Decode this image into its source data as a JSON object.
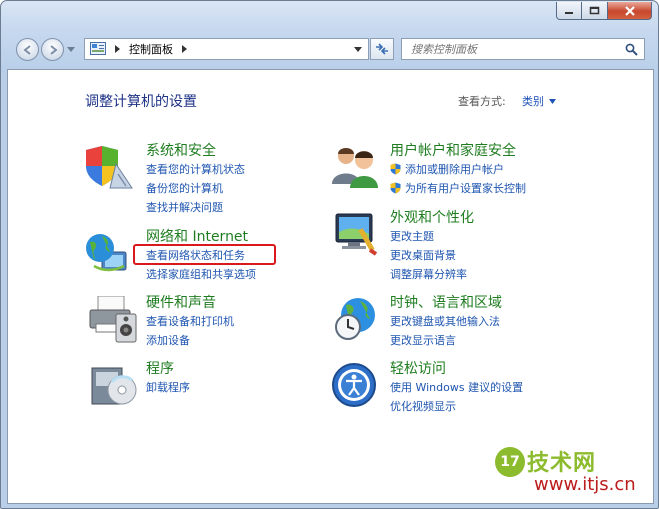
{
  "window": {
    "caption": {
      "minimize_label": "–",
      "maximize_label": "□",
      "close_label": "✕"
    },
    "breadcrumb": {
      "root": "控制面板"
    },
    "search": {
      "placeholder": "搜索控制面板"
    }
  },
  "main": {
    "heading": "调整计算机的设置",
    "view_by_label": "查看方式:",
    "view_by_value": "类别"
  },
  "categories": {
    "system": {
      "title": "系统和安全",
      "links": [
        "查看您的计算机状态",
        "备份您的计算机",
        "查找并解决问题"
      ]
    },
    "network": {
      "title": "网络和 Internet",
      "links": [
        "查看网络状态和任务",
        "选择家庭组和共享选项"
      ]
    },
    "hardware": {
      "title": "硬件和声音",
      "links": [
        "查看设备和打印机",
        "添加设备"
      ]
    },
    "programs": {
      "title": "程序",
      "links": [
        "卸载程序"
      ]
    },
    "users": {
      "title": "用户帐户和家庭安全",
      "links": [
        "添加或删除用户帐户",
        "为所有用户设置家长控制"
      ]
    },
    "appearance": {
      "title": "外观和个性化",
      "links": [
        "更改主题",
        "更改桌面背景",
        "调整屏幕分辨率"
      ]
    },
    "clock": {
      "title": "时钟、语言和区域",
      "links": [
        "更改键盘或其他输入法",
        "更改显示语言"
      ]
    },
    "ease": {
      "title": "轻松访问",
      "links": [
        "使用 Windows 建议的设置",
        "优化视频显示"
      ]
    }
  },
  "watermark": {
    "badge": "17",
    "brand": "技术网",
    "url": "www.itjs.cn"
  },
  "colors": {
    "title_green": "#1f7d20",
    "link_blue": "#1f56b0",
    "heading_blue": "#1e3287",
    "highlight_red": "#d9191b"
  }
}
